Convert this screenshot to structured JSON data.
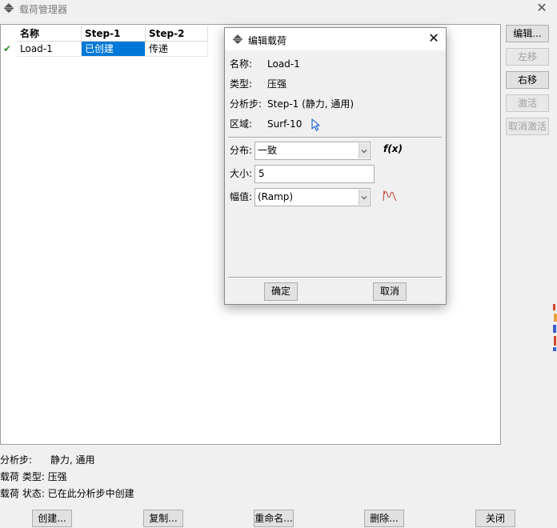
{
  "window": {
    "title": "载荷管理器",
    "close_glyph": "✕",
    "icon": "abaqus-logo-icon"
  },
  "table": {
    "columns": [
      "名称",
      "Step-1",
      "Step-2"
    ],
    "rows": [
      {
        "active_icon": "checkmark-icon",
        "active_glyph": "✔",
        "cells": [
          "Load-1",
          "已创建",
          "传递"
        ]
      }
    ]
  },
  "side_buttons": [
    {
      "label": "编辑...",
      "enabled": true
    },
    {
      "label": "左移",
      "enabled": false
    },
    {
      "label": "右移",
      "enabled": true
    },
    {
      "label": "激活",
      "enabled": false
    },
    {
      "label": "取消激活",
      "enabled": false
    }
  ],
  "status": {
    "step_line": "分析步:      静力, 通用",
    "type_line": "载荷 类型: 压强",
    "state_line": "载荷 状态: 已在此分析步中创建"
  },
  "bottom_buttons": [
    "创建...",
    "复制...",
    "重命名...",
    "删除...",
    "关闭"
  ],
  "dialog": {
    "title": "编辑载荷",
    "close_glyph": "✕",
    "info": [
      {
        "label": "名称:",
        "value": "Load-1"
      },
      {
        "label": "类型:",
        "value": "压强"
      },
      {
        "label": "分析步:",
        "value": "Step-1 (静力, 通用)"
      },
      {
        "label": "区域:",
        "value": "Surf-10"
      }
    ],
    "distribution": {
      "label": "分布:",
      "value": "一致",
      "fx_label": "f(x)"
    },
    "magnitude": {
      "label": "大小:",
      "value": "5"
    },
    "amplitude": {
      "label": "幅值:",
      "value": "(Ramp)"
    },
    "ok_label": "确定",
    "cancel_label": "取消"
  },
  "colors": {
    "selection": "#0078d7",
    "check": "#2e8b2e",
    "cursor": "#3a78d6",
    "amplitude_curve": "#c0392b"
  }
}
